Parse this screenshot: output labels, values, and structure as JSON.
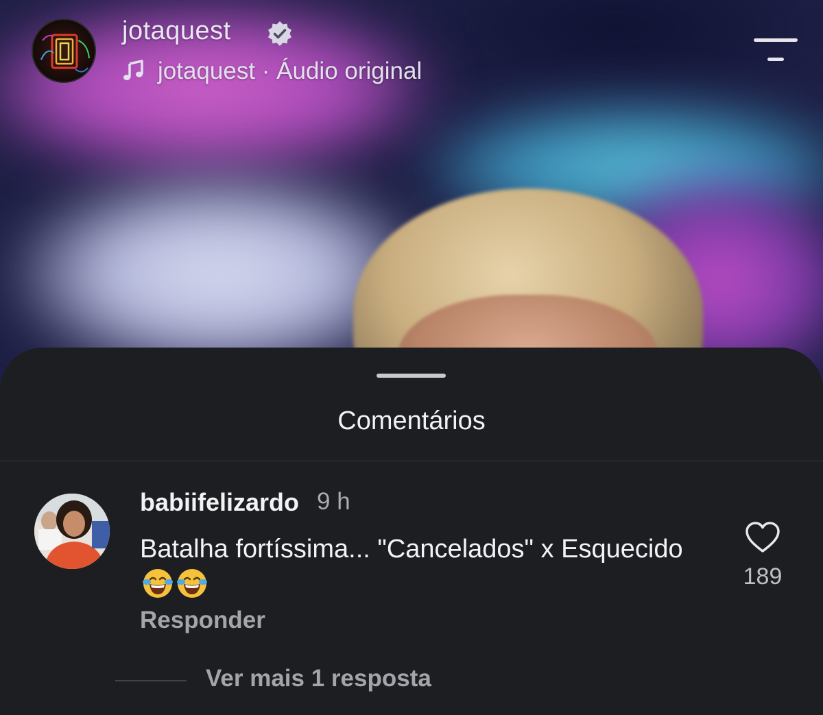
{
  "header": {
    "username": "jotaquest",
    "audio_label": "jotaquest · Áudio original",
    "icons": {
      "avatar": "jotaquest-logo-avatar",
      "verified": "verified-badge-icon",
      "music": "music-note-icon",
      "menu": "menu-icon"
    }
  },
  "comments_sheet": {
    "title": "Comentários",
    "comments": [
      {
        "username": "babiifelizardo",
        "time": "9 h",
        "text": "Batalha fortíssima... \"Cancelados\" x Esquecido",
        "emoji": "😂😂",
        "reply_label": "Responder",
        "likes": "189",
        "more_replies_label": "Ver mais 1 resposta"
      }
    ]
  },
  "colors": {
    "sheet_bg": "#1c1e22",
    "primary_text": "#f3f3f5",
    "secondary_text": "#a3a5aa"
  }
}
